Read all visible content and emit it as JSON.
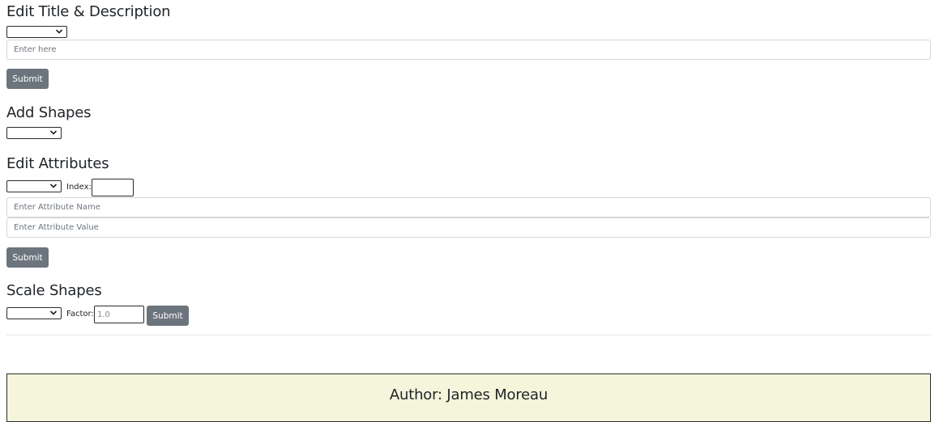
{
  "edit_title": {
    "heading": "Edit Title & Description",
    "select_value": "",
    "input_placeholder": "Enter here",
    "submit_label": "Submit"
  },
  "add_shapes": {
    "heading": "Add Shapes",
    "select_value": ""
  },
  "edit_attributes": {
    "heading": "Edit Attributes",
    "select_value": "",
    "index_label": "Index:",
    "index_value": "",
    "name_placeholder": "Enter Attribute Name",
    "value_placeholder": "Enter Attribute Value",
    "submit_label": "Submit"
  },
  "scale_shapes": {
    "heading": "Scale Shapes",
    "select_value": "",
    "factor_label": "Factor:",
    "factor_placeholder": "1.0",
    "submit_label": "Submit"
  },
  "footer": {
    "author_text": "Author: James Moreau"
  },
  "colors": {
    "button_bg": "#6c757d",
    "footer_bg": "#f5f5dc"
  },
  "icons": {
    "select_arrow": "chevron-down-icon"
  }
}
